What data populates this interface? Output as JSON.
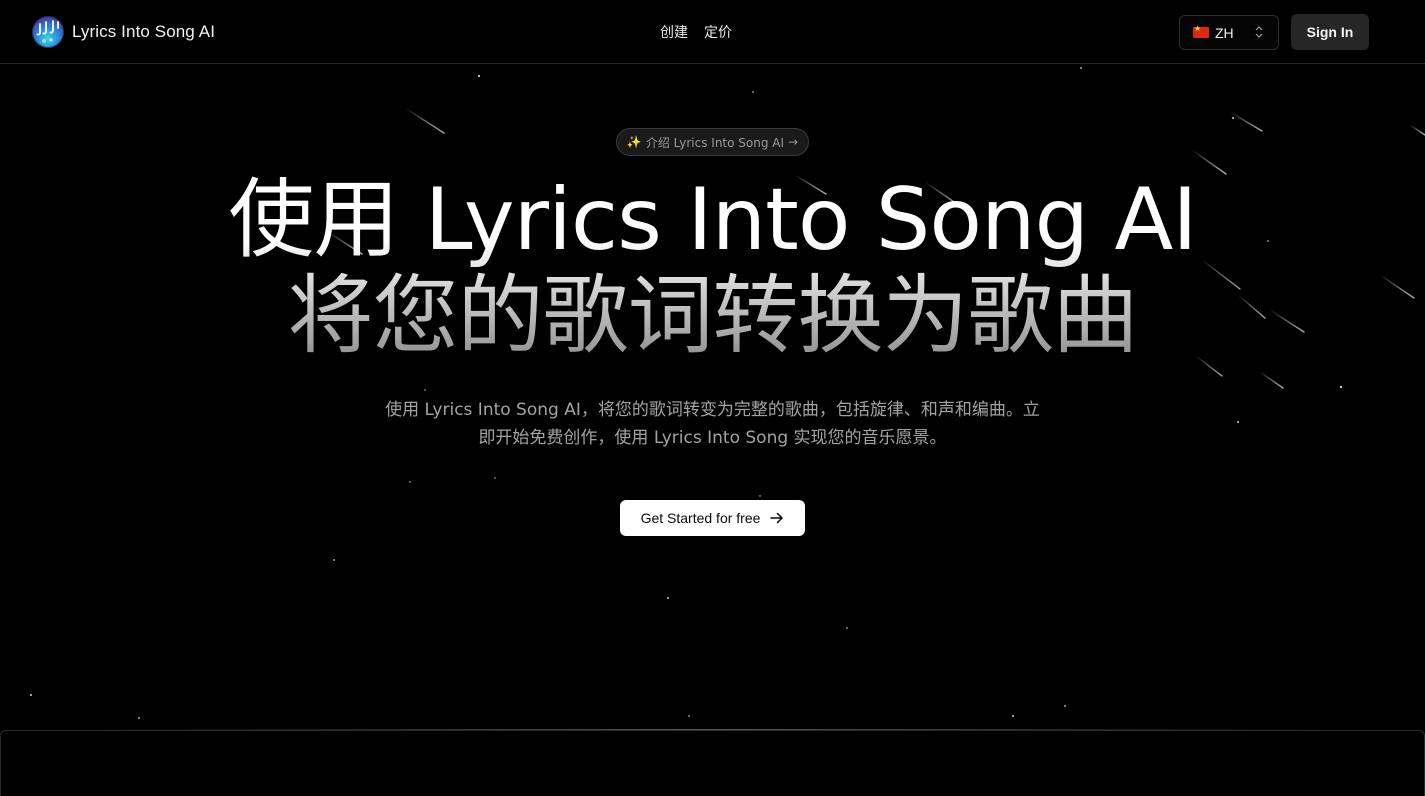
{
  "header": {
    "brand_name": "Lyrics Into Song AI",
    "nav": [
      {
        "label": "创建"
      },
      {
        "label": "定价"
      }
    ],
    "language": {
      "code": "ZH"
    },
    "sign_in_label": "Sign In"
  },
  "hero": {
    "badge_icon": "✨",
    "badge_text": "介绍 Lyrics Into Song AI",
    "badge_arrow": "→",
    "title_line1": "使用 Lyrics Into Song AI",
    "title_line2": "将您的歌词转换为歌曲",
    "subtitle": "使用 Lyrics Into Song AI，将您的歌词转变为完整的歌曲，包括旋律、和声和编曲。立即开始免费创作，使用 Lyrics Into Song 实现您的音乐愿景。",
    "cta_label": "Get Started for free"
  },
  "colors": {
    "background": "#000000",
    "cta_bg": "#ffffff",
    "signin_bg": "#262626",
    "muted_text": "#a3a3a3"
  },
  "icons": {
    "logo": "music-notes-logo-icon",
    "flag": "china-flag-icon",
    "select": "chevron-up-down-icon",
    "cta": "arrow-right-icon",
    "badge": "sparkles-icon"
  }
}
